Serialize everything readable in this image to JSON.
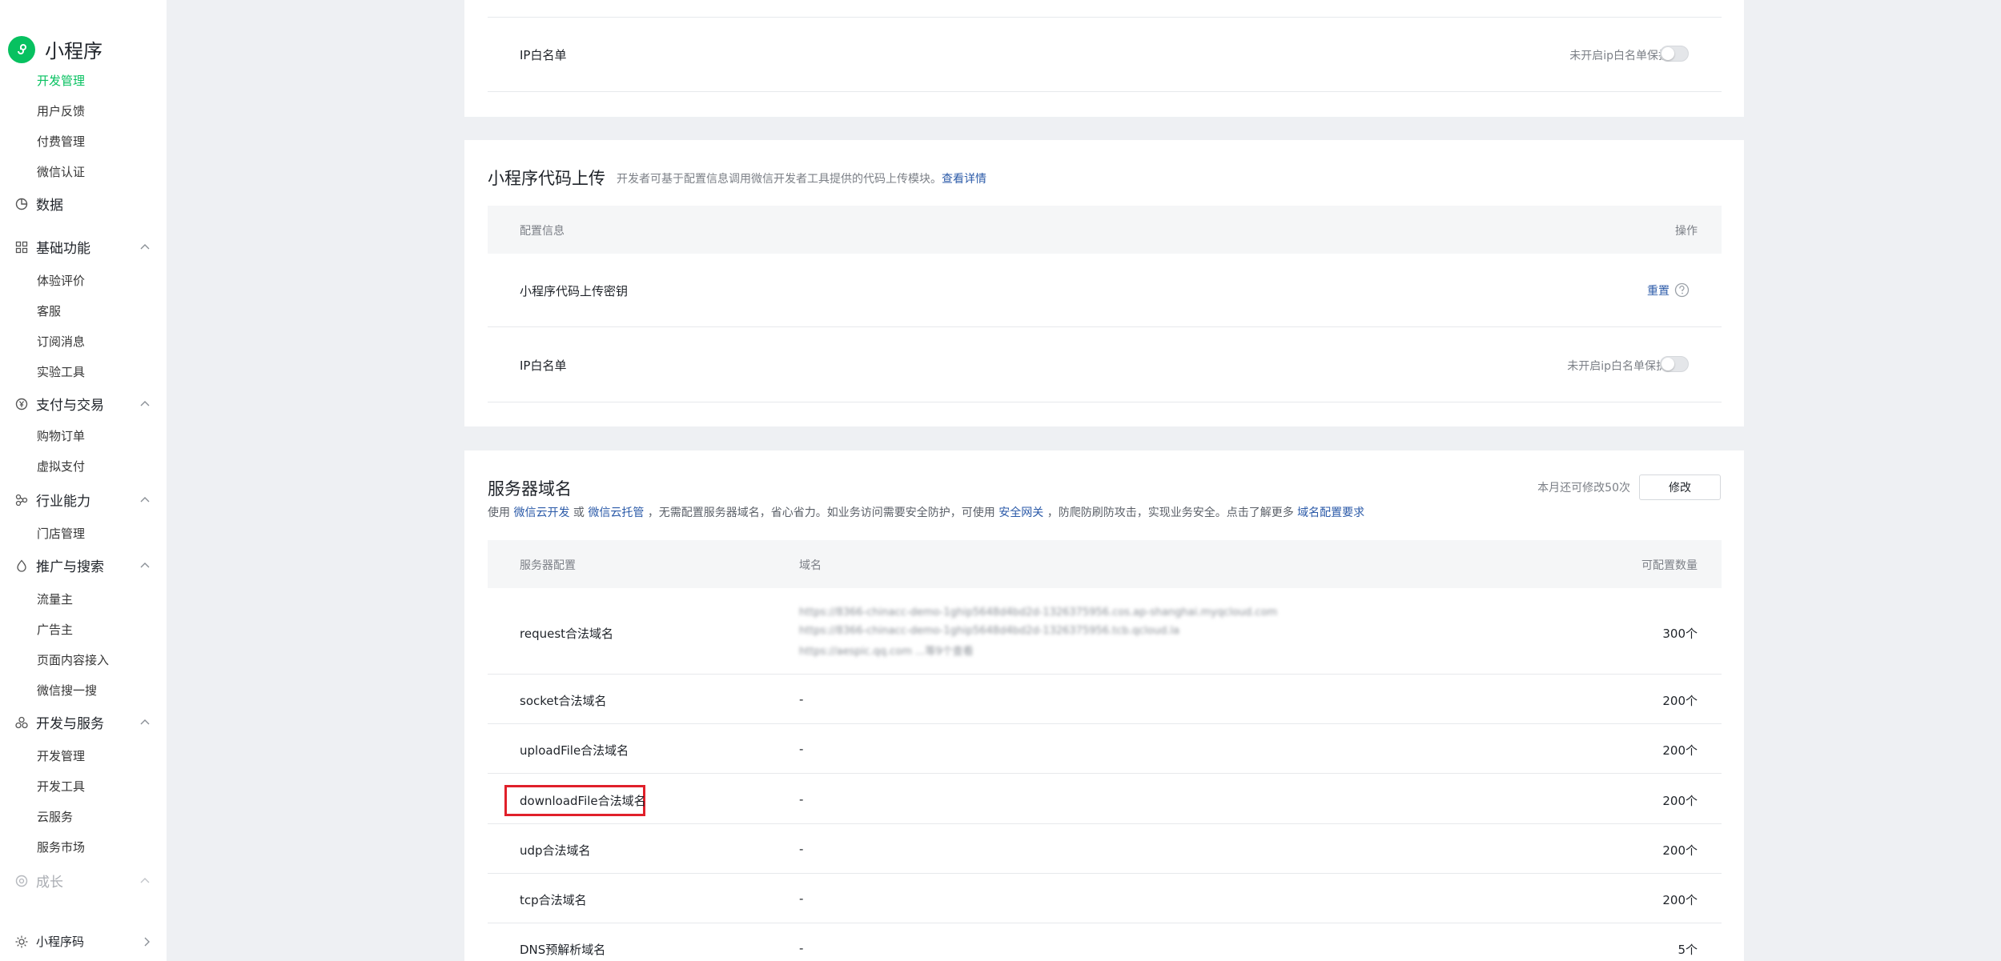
{
  "sidebar": {
    "app_name": "小程序",
    "items": [
      {
        "label": "开发管理",
        "kind": "sub",
        "active": true
      },
      {
        "label": "用户反馈",
        "kind": "sub"
      },
      {
        "label": "付费管理",
        "kind": "sub"
      },
      {
        "label": "微信认证",
        "kind": "sub"
      },
      {
        "label": "数据",
        "kind": "head",
        "icon": "chart-pie-icon"
      },
      {
        "label": "基础功能",
        "kind": "head",
        "icon": "grid-icon"
      },
      {
        "label": "体验评价",
        "kind": "sub"
      },
      {
        "label": "客服",
        "kind": "sub"
      },
      {
        "label": "订阅消息",
        "kind": "sub"
      },
      {
        "label": "实验工具",
        "kind": "sub"
      },
      {
        "label": "支付与交易",
        "kind": "head",
        "icon": "yuan-circle-icon"
      },
      {
        "label": "购物订单",
        "kind": "sub"
      },
      {
        "label": "虚拟支付",
        "kind": "sub"
      },
      {
        "label": "行业能力",
        "kind": "head",
        "icon": "share-icon"
      },
      {
        "label": "门店管理",
        "kind": "sub"
      },
      {
        "label": "推广与搜索",
        "kind": "head",
        "icon": "flame-icon"
      },
      {
        "label": "流量主",
        "kind": "sub"
      },
      {
        "label": "广告主",
        "kind": "sub"
      },
      {
        "label": "页面内容接入",
        "kind": "sub"
      },
      {
        "label": "微信搜一搜",
        "kind": "sub"
      },
      {
        "label": "开发与服务",
        "kind": "head",
        "icon": "nodes-icon"
      },
      {
        "label": "开发管理",
        "kind": "sub"
      },
      {
        "label": "开发工具",
        "kind": "sub"
      },
      {
        "label": "云服务",
        "kind": "sub"
      },
      {
        "label": "服务市场",
        "kind": "sub"
      },
      {
        "label": "成长",
        "kind": "head",
        "icon": "growth-icon"
      }
    ],
    "footer": {
      "label": "小程序码",
      "icon": "sun-icon"
    }
  },
  "card_top": {
    "ip_label": "IP白名单",
    "ip_status": "未开启ip白名单保护"
  },
  "upload": {
    "title": "小程序代码上传",
    "desc": "开发者可基于配置信息调用微信开发者工具提供的代码上传模块。",
    "desc_link": "查看详情",
    "col_config": "配置信息",
    "col_action": "操作",
    "key_label": "小程序代码上传密钥",
    "reset_label": "重置",
    "ip_label": "IP白名单",
    "ip_status": "未开启ip白名单保护"
  },
  "domain": {
    "title": "服务器域名",
    "quota_text": "本月还可修改50次",
    "edit_label": "修改",
    "desc_p1": "使用",
    "desc_link1": "微信云开发",
    "desc_p2": "或",
    "desc_link2": "微信云托管",
    "desc_p3": "，无需配置服务器域名，省心省力。如业务访问需要安全防护，可使用",
    "desc_link3": "安全网关",
    "desc_p4": "，防爬防刷防攻击，实现业务安全。点击了解更多",
    "desc_link4": "域名配置要求",
    "col_config": "服务器配置",
    "col_domain": "域名",
    "col_count": "可配置数量",
    "rows": [
      {
        "name": "request合法域名",
        "domain_lines": [
          "https://8366-chinacc-demo-1ghip5648d4bd2d-1326375956.cos.ap-shanghai.myqcloud.com",
          "https://8366-chinacc-demo-1ghip5648d4bd2d-1326375956.tcb.qcloud.la",
          "https://aespic.qq.com ...等9个查看"
        ],
        "count": "300个"
      },
      {
        "name": "socket合法域名",
        "domain": "-",
        "count": "200个"
      },
      {
        "name": "uploadFile合法域名",
        "domain": "-",
        "count": "200个"
      },
      {
        "name": "downloadFile合法域名",
        "domain": "-",
        "count": "200个"
      },
      {
        "name": "udp合法域名",
        "domain": "-",
        "count": "200个"
      },
      {
        "name": "tcp合法域名",
        "domain": "-",
        "count": "200个"
      },
      {
        "name": "DNS预解析域名",
        "domain": "-",
        "count": "5个"
      }
    ]
  }
}
